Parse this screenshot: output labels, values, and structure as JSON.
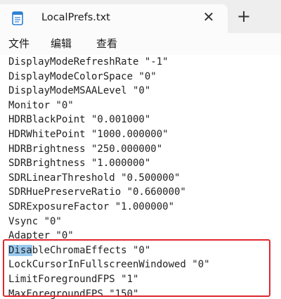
{
  "tab": {
    "title": "LocalPrefs.txt",
    "close_glyph": "✕",
    "icon": "notepad-file-icon"
  },
  "new_tab_glyph": "+",
  "menu": [
    {
      "label": "文件"
    },
    {
      "label": "编辑"
    },
    {
      "label": "查看"
    }
  ],
  "editor": {
    "lines": [
      "DisplayModeRefreshRate \"-1\"",
      "DisplayModeColorSpace \"0\"",
      "DisplayModeMSAALevel \"0\"",
      "Monitor \"0\"",
      "HDRBlackPoint \"0.001000\"",
      "HDRWhitePoint \"1000.000000\"",
      "HDRBrightness \"250.000000\"",
      "SDRBrightness \"1.000000\"",
      "SDRLinearThreshold \"0.500000\"",
      "SDRHuePreserveRatio \"0.660000\"",
      "SDRExposureFactor \"1.000000\"",
      "Vsync \"0\"",
      "Adapter \"0\"",
      "",
      "LockCursorInFullscreenWindowed \"0\"",
      "LimitForegroundFPS \"1\"",
      "MaxForegroundFPS \"150\""
    ],
    "selected_line": {
      "selected_text": "Disa",
      "rest_text": "bleChromaEffects \"0\""
    }
  },
  "colors": {
    "highlight_border": "#e0272e",
    "selection": "#99c9ef"
  }
}
